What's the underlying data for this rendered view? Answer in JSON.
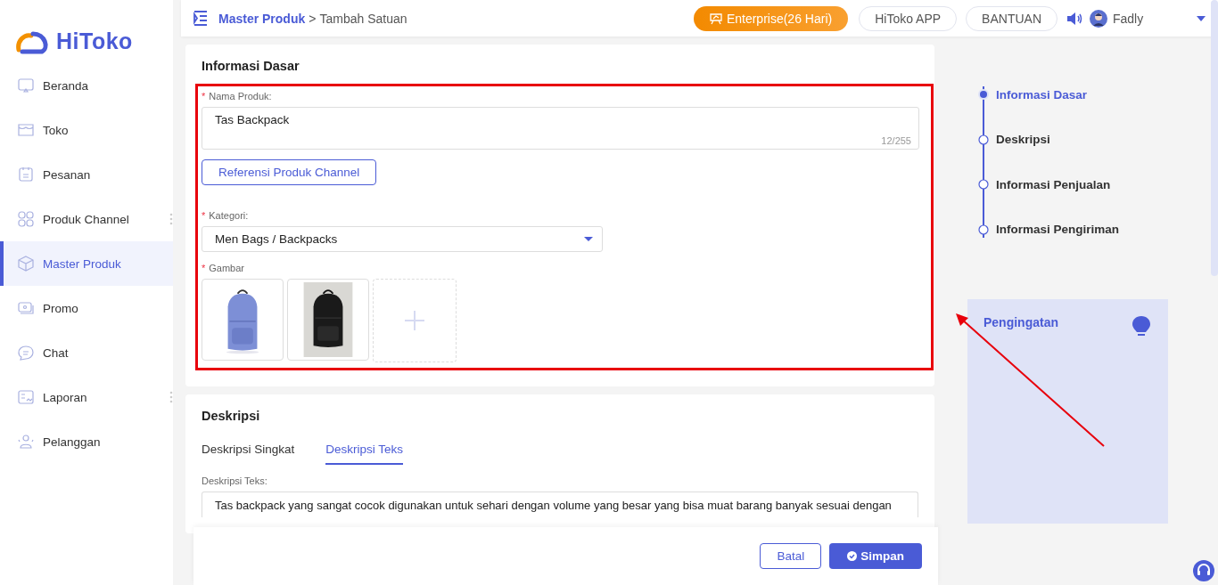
{
  "logo": {
    "text": "HiToko"
  },
  "sidebar": {
    "items": [
      {
        "label": "Beranda",
        "selected": false,
        "has_menu": false
      },
      {
        "label": "Toko",
        "selected": false,
        "has_menu": false
      },
      {
        "label": "Pesanan",
        "selected": false,
        "has_menu": false
      },
      {
        "label": "Produk Channel",
        "selected": false,
        "has_menu": true
      },
      {
        "label": "Master Produk",
        "selected": true,
        "has_menu": false
      },
      {
        "label": "Promo",
        "selected": false,
        "has_menu": false
      },
      {
        "label": "Chat",
        "selected": false,
        "has_menu": false
      },
      {
        "label": "Laporan",
        "selected": false,
        "has_menu": true
      },
      {
        "label": "Pelanggan",
        "selected": false,
        "has_menu": false
      }
    ]
  },
  "topbar": {
    "breadcrumb": {
      "parent": "Master Produk",
      "separator": ">",
      "current": "Tambah Satuan"
    },
    "plan_button": "Enterprise(26 Hari)",
    "buttons": [
      "HiToko APP",
      "BANTUAN"
    ],
    "user": "Fadly"
  },
  "basic_info": {
    "title": "Informasi Dasar",
    "name_field": {
      "label": "Nama Produk:",
      "required_mark": "*",
      "value": "Tas Backpack",
      "counter": "12/255"
    },
    "reference_button": "Referensi Produk Channel",
    "category_field": {
      "label": "Kategori:",
      "required_mark": "*",
      "value": "Men Bags / Backpacks"
    },
    "images": {
      "label": "Gambar",
      "required_mark": "*"
    }
  },
  "description": {
    "title": "Deskripsi",
    "tabs": [
      {
        "label": "Deskripsi Singkat",
        "selected": false
      },
      {
        "label": "Deskripsi Teks",
        "selected": true
      }
    ],
    "field": {
      "label": "Deskripsi Teks:",
      "value": "Tas backpack yang sangat cocok digunakan untuk sehari dengan volume yang besar yang bisa muat barang banyak sesuai dengan"
    }
  },
  "steps": [
    {
      "label": "Informasi Dasar",
      "selected": true
    },
    {
      "label": "Deskripsi",
      "selected": false
    },
    {
      "label": "Informasi Penjualan",
      "selected": false
    },
    {
      "label": "Informasi Pengiriman",
      "selected": false
    }
  ],
  "reminder": {
    "title": "Pengingatan"
  },
  "footer": {
    "cancel_button": "Batal",
    "save_button": "Simpan"
  },
  "annotations": {
    "highlight_box": true,
    "arrow": true
  }
}
